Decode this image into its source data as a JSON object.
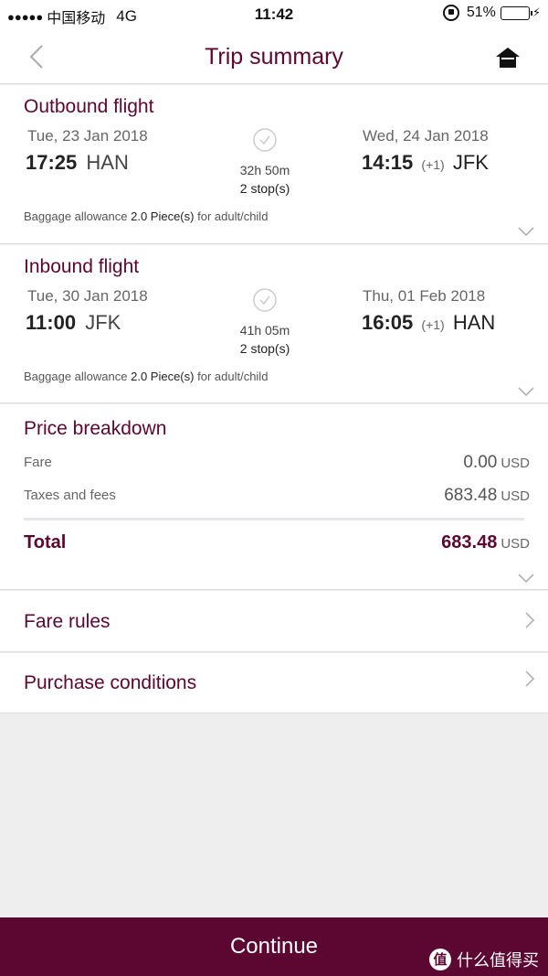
{
  "status_bar": {
    "signal": "●●●●●",
    "carrier": "中国移动",
    "network": "4G",
    "time": "11:42",
    "battery": "51%",
    "battery_level": 0.51,
    "battery_color": "#4cd964"
  },
  "nav": {
    "title": "Trip summary",
    "back_icon": "chevron-left-icon",
    "home_icon": "home-icon"
  },
  "outbound": {
    "title": "Outbound flight",
    "depart_date": "Tue, 23 Jan 2018",
    "depart_time": "17:25",
    "depart_code": "HAN",
    "arrive_date": "Wed, 24 Jan 2018",
    "arrive_time": "14:15",
    "arrive_plus": "(+1)",
    "arrive_code": "JFK",
    "duration": "32h 50m",
    "stops": "2 stop(s)",
    "baggage_prefix": "Baggage allowance",
    "baggage_value": "2.0 Piece(s)",
    "baggage_suffix": "for adult/child"
  },
  "inbound": {
    "title": "Inbound flight",
    "depart_date": "Tue, 30 Jan 2018",
    "depart_time": "11:00",
    "depart_code": "JFK",
    "arrive_date": "Thu, 01 Feb 2018",
    "arrive_time": "16:05",
    "arrive_plus": "(+1)",
    "arrive_code": "HAN",
    "duration": "41h 05m",
    "stops": "2 stop(s)",
    "baggage_prefix": "Baggage allowance",
    "baggage_value": "2.0 Piece(s)",
    "baggage_suffix": "for adult/child"
  },
  "price": {
    "title": "Price breakdown",
    "fare_label": "Fare",
    "fare_value": "0.00",
    "fare_currency": "USD",
    "taxes_label": "Taxes and fees",
    "taxes_value": "683.48",
    "taxes_currency": "USD",
    "total_label": "Total",
    "total_value": "683.48",
    "total_currency": "USD"
  },
  "links": {
    "fare_rules": "Fare rules",
    "purchase_conditions": "Purchase conditions"
  },
  "continue_label": "Continue",
  "watermark": {
    "badge": "值",
    "text": "什么值得买"
  },
  "colors": {
    "brand": "#5c0632",
    "background": "#eeeeee"
  }
}
